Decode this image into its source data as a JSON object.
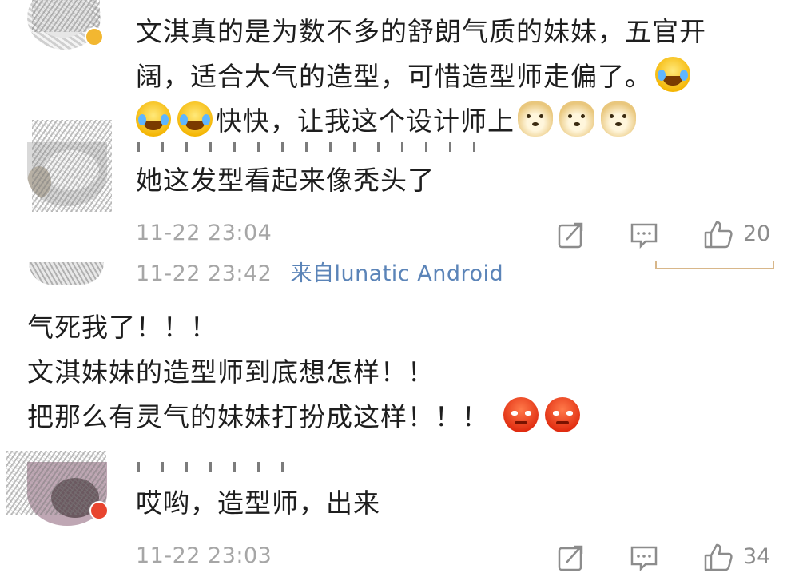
{
  "comments": [
    {
      "lines": [
        "文淇真的是为数不多的舒朗气质的妹妹，五官开",
        "阔，适合大气的造型，可惜造型师走偏了。",
        "快快，让我这个设计师上"
      ]
    },
    {
      "text": "她这发型看起来像秃头了",
      "time": "11-22 23:04",
      "likes": "20"
    },
    {
      "time": "11-22 23:42",
      "source": "来自lunatic Android",
      "lines": [
        "气死我了！！！",
        "文淇妹妹的造型师到底想怎样！！",
        "把那么有灵气的妹妹打扮成这样！！！"
      ]
    },
    {
      "text": "哎哟，造型师，出来",
      "time": "11-22 23:03",
      "likes": "34"
    }
  ],
  "icons": {
    "repost": "repost-icon",
    "comment": "comment-icon",
    "like": "like-icon",
    "emoji_laugh": "laugh-cry-emoji",
    "emoji_doge": "doge-emoji",
    "emoji_angry": "angry-emoji"
  },
  "colors": {
    "text": "#1e1e1e",
    "meta": "#a6a6a6",
    "source": "#5b84b8"
  }
}
